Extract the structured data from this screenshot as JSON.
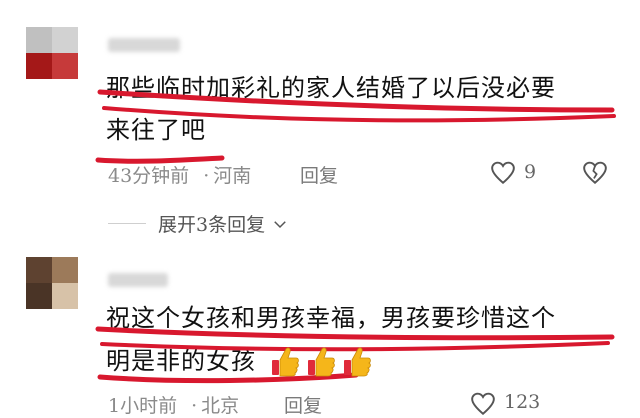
{
  "comments": [
    {
      "text_line1": "那些临时加彩礼的家人结婚了以后没必要",
      "text_line2": "来往了吧",
      "time": "43分钟前",
      "location": "河南",
      "reply_label": "回复",
      "like_count": "9",
      "expand_label": "展开3条回复",
      "like_icon": "heart-outline-icon",
      "dislike_icon": "broken-heart-icon"
    },
    {
      "text_line1": "祝这个女孩和男孩幸福，男孩要珍惜这个",
      "text_line2": "明是非的女孩",
      "emoji": "thumbs-up-icon",
      "emoji_count": 3,
      "time": "1小时前",
      "location": "北京",
      "reply_label": "回复",
      "like_count": "123",
      "like_icon": "heart-outline-icon"
    }
  ],
  "colors": {
    "marker": "#d8182e",
    "meta": "#8a8a8a"
  }
}
